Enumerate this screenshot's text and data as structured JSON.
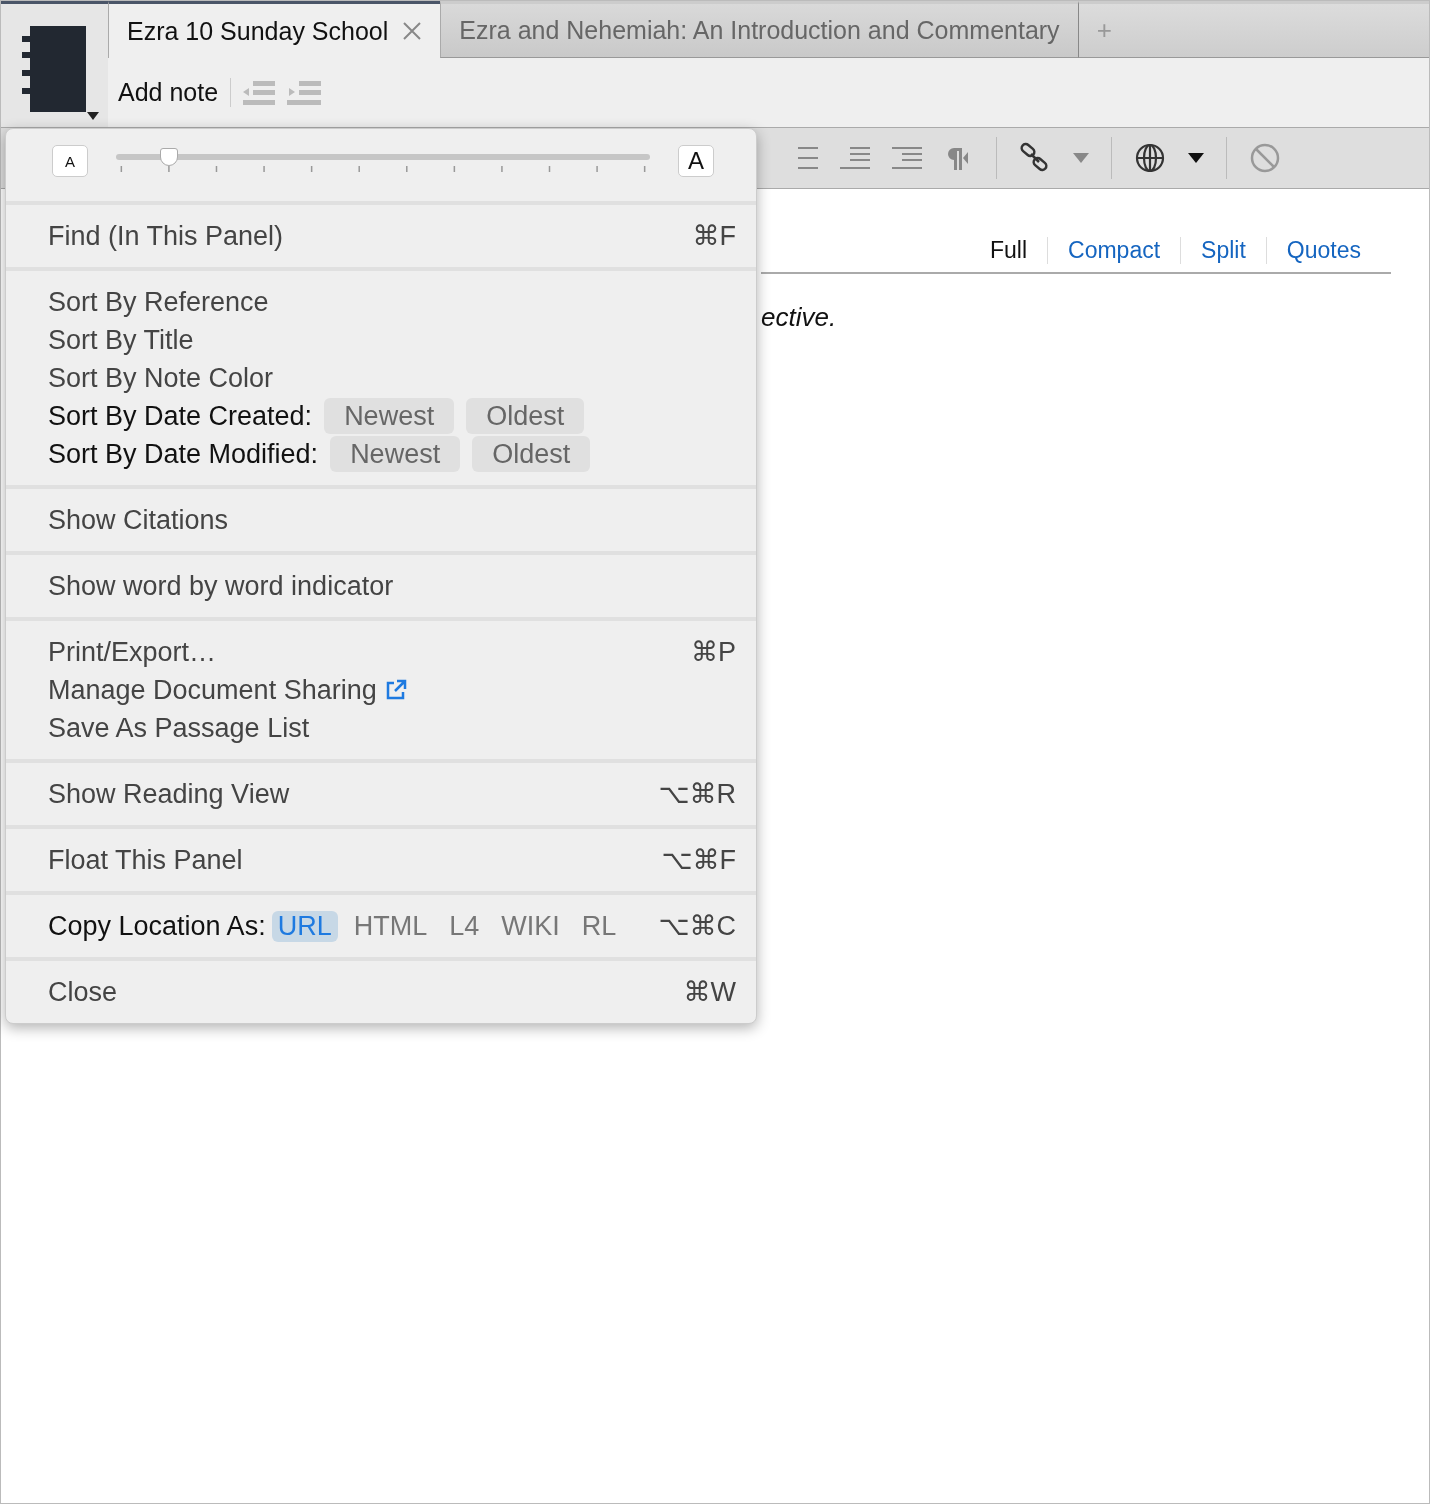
{
  "tabs": [
    {
      "label": "Ezra 10 Sunday School",
      "selected": true,
      "closable": true
    },
    {
      "label": "Ezra and Nehemiah: An Introduction and Commentary",
      "selected": false,
      "closable": false
    }
  ],
  "new_tab": "+",
  "toolbar": {
    "add_note": "Add note"
  },
  "view_tabs": [
    {
      "label": "Full",
      "selected": true
    },
    {
      "label": "Compact",
      "selected": false
    },
    {
      "label": "Split",
      "selected": false
    },
    {
      "label": "Quotes",
      "selected": false
    }
  ],
  "content_text": "ective.",
  "menu": {
    "font_size": {
      "small": "A",
      "large": "A",
      "level": 0.1
    },
    "sections": [
      [
        {
          "kind": "command",
          "label": "Find (In This Panel)",
          "shortcut": "⌘F"
        }
      ],
      [
        {
          "kind": "command",
          "label": "Sort By Reference"
        },
        {
          "kind": "command",
          "label": "Sort By Title"
        },
        {
          "kind": "command",
          "label": "Sort By Note Color"
        },
        {
          "kind": "sort",
          "label": "Sort By Date Created:",
          "options": [
            {
              "label": "Newest",
              "selected": false
            },
            {
              "label": "Oldest",
              "selected": false
            }
          ]
        },
        {
          "kind": "sort",
          "label": "Sort By Date Modified:",
          "options": [
            {
              "label": "Newest",
              "selected": false
            },
            {
              "label": "Oldest",
              "selected": false
            }
          ]
        }
      ],
      [
        {
          "kind": "command",
          "label": "Show Citations"
        }
      ],
      [
        {
          "kind": "command",
          "label": "Show word by word indicator"
        }
      ],
      [
        {
          "kind": "command",
          "label": "Print/Export…",
          "shortcut": "⌘P"
        },
        {
          "kind": "link",
          "label": "Manage Document Sharing"
        },
        {
          "kind": "command",
          "label": "Save As Passage List"
        }
      ],
      [
        {
          "kind": "command",
          "label": "Show Reading View",
          "shortcut": "⌥⌘R"
        }
      ],
      [
        {
          "kind": "command",
          "label": "Float This Panel",
          "shortcut": "⌥⌘F"
        }
      ],
      [
        {
          "kind": "copy",
          "label": "Copy Location As:",
          "options": [
            {
              "label": "URL",
              "selected": true
            },
            {
              "label": "HTML",
              "selected": false
            },
            {
              "label": "L4",
              "selected": false
            },
            {
              "label": "WIKI",
              "selected": false
            },
            {
              "label": "RL",
              "selected": false
            }
          ],
          "shortcut": "⌥⌘C"
        }
      ],
      [
        {
          "kind": "command",
          "label": "Close",
          "shortcut": "⌘W"
        }
      ]
    ]
  }
}
